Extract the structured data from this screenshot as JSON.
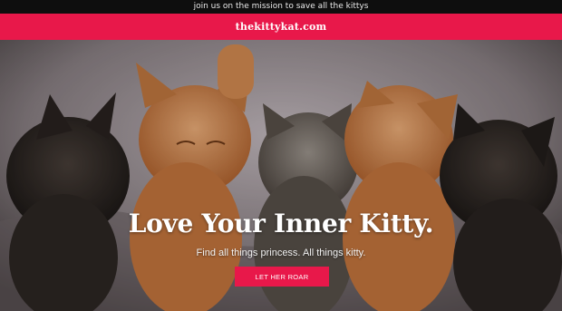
{
  "announcement": {
    "text": "join us on the mission to save all the kittys"
  },
  "brand": {
    "name": "thekittykat.com"
  },
  "hero": {
    "headline": "Love Your Inner Kitty.",
    "subtitle": "Find all things princess. All things kitty.",
    "cta_label": "LET HER ROAR",
    "image_subject": "five-sleeping-kittens",
    "colors": {
      "accent": "#e8184a",
      "topbar": "#0e0e0e"
    }
  }
}
